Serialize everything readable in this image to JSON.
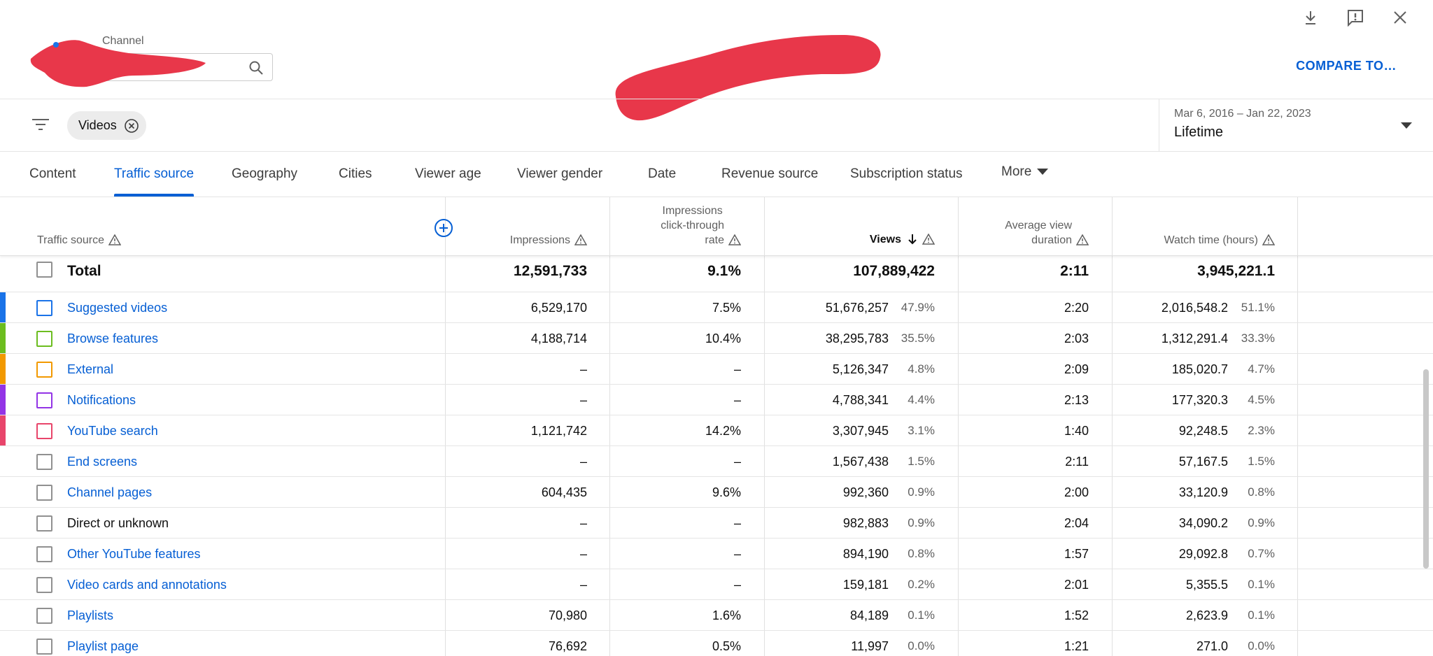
{
  "header": {
    "channel_label": "Channel",
    "compare_label": "COMPARE TO…",
    "icons": [
      "download-icon",
      "feedback-icon",
      "close-icon"
    ]
  },
  "filters": {
    "chip_label": "Videos",
    "date_range": "Mar 6, 2016 – Jan 22, 2023",
    "date_preset": "Lifetime"
  },
  "tabs": [
    {
      "label": "Content"
    },
    {
      "label": "Traffic source"
    },
    {
      "label": "Geography"
    },
    {
      "label": "Cities"
    },
    {
      "label": "Viewer age"
    },
    {
      "label": "Viewer gender"
    },
    {
      "label": "Date"
    },
    {
      "label": "Revenue source"
    },
    {
      "label": "Subscription status"
    },
    {
      "label": "More"
    }
  ],
  "active_tab": "Traffic source",
  "table": {
    "columns": {
      "source": "Traffic source",
      "impressions": "Impressions",
      "ctr_line1": "Impressions",
      "ctr_line2": "click-through",
      "ctr_line3": "rate",
      "views": "Views",
      "avd_line1": "Average view",
      "avd_line2": "duration",
      "watch_time": "Watch time (hours)"
    },
    "total": {
      "label": "Total",
      "impressions": "12,591,733",
      "ctr": "9.1%",
      "views": "107,889,422",
      "avd": "2:11",
      "watch_time": "3,945,221.1"
    },
    "rows": [
      {
        "label": "Suggested videos",
        "impressions": "6,529,170",
        "ctr": "7.5%",
        "views": "51,676,257",
        "views_pct": "47.9%",
        "avd": "2:20",
        "watch_time": "2,016,548.2",
        "wt_pct": "51.1%",
        "color": "#1a73e8",
        "link": true
      },
      {
        "label": "Browse features",
        "impressions": "4,188,714",
        "ctr": "10.4%",
        "views": "38,295,783",
        "views_pct": "35.5%",
        "avd": "2:03",
        "watch_time": "1,312,291.4",
        "wt_pct": "33.3%",
        "color": "#6cbd1f",
        "link": true
      },
      {
        "label": "External",
        "impressions": "–",
        "ctr": "–",
        "views": "5,126,347",
        "views_pct": "4.8%",
        "avd": "2:09",
        "watch_time": "185,020.7",
        "wt_pct": "4.7%",
        "color": "#f29900",
        "link": true
      },
      {
        "label": "Notifications",
        "impressions": "–",
        "ctr": "–",
        "views": "4,788,341",
        "views_pct": "4.4%",
        "avd": "2:13",
        "watch_time": "177,320.3",
        "wt_pct": "4.5%",
        "color": "#9334e6",
        "link": true
      },
      {
        "label": "YouTube search",
        "impressions": "1,121,742",
        "ctr": "14.2%",
        "views": "3,307,945",
        "views_pct": "3.1%",
        "avd": "1:40",
        "watch_time": "92,248.5",
        "wt_pct": "2.3%",
        "color": "#e8456b",
        "link": true
      },
      {
        "label": "End screens",
        "impressions": "–",
        "ctr": "–",
        "views": "1,567,438",
        "views_pct": "1.5%",
        "avd": "2:11",
        "watch_time": "57,167.5",
        "wt_pct": "1.5%",
        "color": "",
        "link": true
      },
      {
        "label": "Channel pages",
        "impressions": "604,435",
        "ctr": "9.6%",
        "views": "992,360",
        "views_pct": "0.9%",
        "avd": "2:00",
        "watch_time": "33,120.9",
        "wt_pct": "0.8%",
        "color": "",
        "link": true
      },
      {
        "label": "Direct or unknown",
        "impressions": "–",
        "ctr": "–",
        "views": "982,883",
        "views_pct": "0.9%",
        "avd": "2:04",
        "watch_time": "34,090.2",
        "wt_pct": "0.9%",
        "color": "",
        "link": false
      },
      {
        "label": "Other YouTube features",
        "impressions": "–",
        "ctr": "–",
        "views": "894,190",
        "views_pct": "0.8%",
        "avd": "1:57",
        "watch_time": "29,092.8",
        "wt_pct": "0.7%",
        "color": "",
        "link": true
      },
      {
        "label": "Video cards and annotations",
        "impressions": "–",
        "ctr": "–",
        "views": "159,181",
        "views_pct": "0.2%",
        "avd": "2:01",
        "watch_time": "5,355.5",
        "wt_pct": "0.1%",
        "color": "",
        "link": true
      },
      {
        "label": "Playlists",
        "impressions": "70,980",
        "ctr": "1.6%",
        "views": "84,189",
        "views_pct": "0.1%",
        "avd": "1:52",
        "watch_time": "2,623.9",
        "wt_pct": "0.1%",
        "color": "",
        "link": true
      },
      {
        "label": "Playlist page",
        "impressions": "76,692",
        "ctr": "0.5%",
        "views": "11,997",
        "views_pct": "0.0%",
        "avd": "1:21",
        "watch_time": "271.0",
        "wt_pct": "0.0%",
        "color": "",
        "link": true
      }
    ]
  },
  "colors": {
    "accent": "#065fd4",
    "redaction": "#e8374a"
  }
}
